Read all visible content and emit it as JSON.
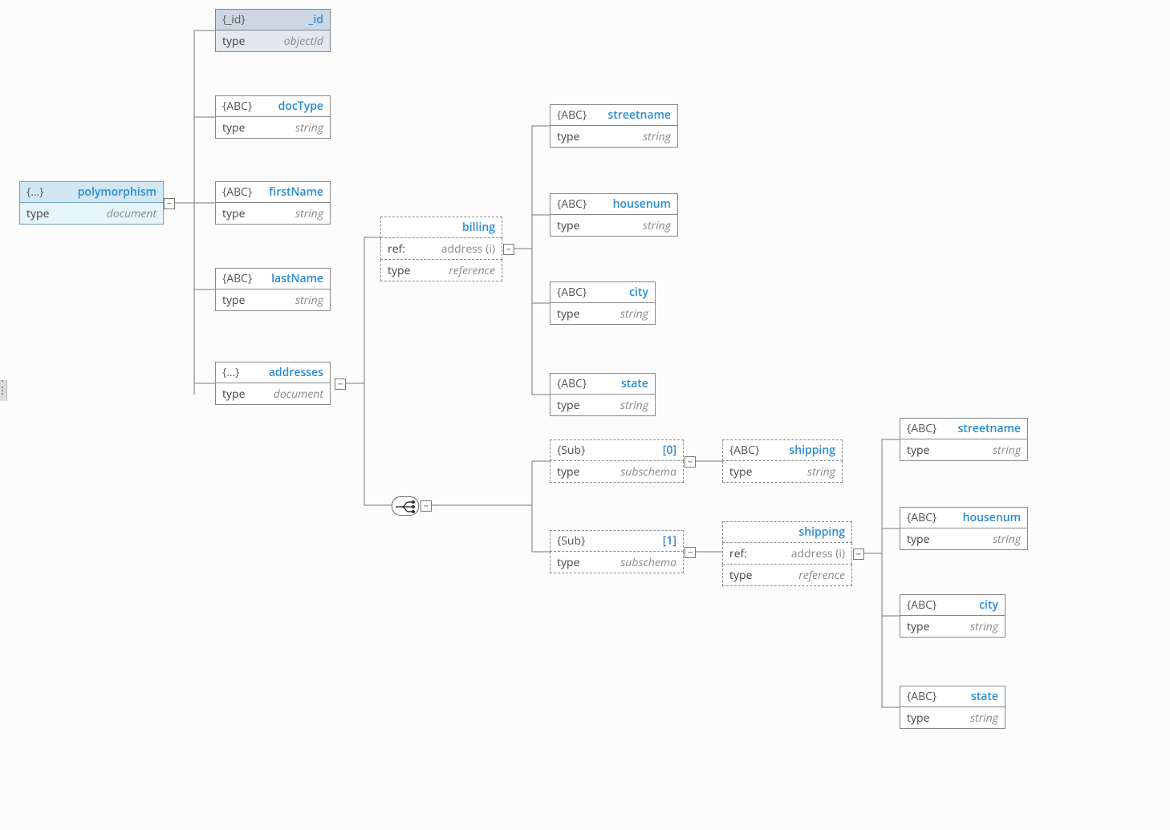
{
  "labels": {
    "type": "type",
    "ref": "ref:"
  },
  "types": {
    "document": "document",
    "objectId": "objectId",
    "string": "string",
    "reference": "reference",
    "subschema": "subschema"
  },
  "tags": {
    "obj": "{…}",
    "id": "{_id}",
    "abc": "{ABC}",
    "sub": "{Sub}"
  },
  "root": {
    "name": "polymorphism",
    "type": "document"
  },
  "fields": {
    "id": {
      "name": "_id",
      "type": "objectId"
    },
    "docType": {
      "name": "docType",
      "type": "string"
    },
    "firstName": {
      "name": "firstName",
      "type": "string"
    },
    "lastName": {
      "name": "lastName",
      "type": "string"
    },
    "addresses": {
      "name": "addresses",
      "type": "document"
    }
  },
  "billing": {
    "name": "billing",
    "ref": "address (i)",
    "type": "reference",
    "fields": {
      "streetname": {
        "name": "streetname",
        "type": "string"
      },
      "housenum": {
        "name": "housenum",
        "type": "string"
      },
      "city": {
        "name": "city",
        "type": "string"
      },
      "state": {
        "name": "state",
        "type": "string"
      }
    }
  },
  "oneof": {
    "0": {
      "idx": "[0]",
      "type": "subschema",
      "child": {
        "name": "shipping",
        "type": "string"
      }
    },
    "1": {
      "idx": "[1]",
      "type": "subschema",
      "child": {
        "name": "shipping",
        "ref": "address (i)",
        "type": "reference",
        "fields": {
          "streetname": {
            "name": "streetname",
            "type": "string"
          },
          "housenum": {
            "name": "housenum",
            "type": "string"
          },
          "city": {
            "name": "city",
            "type": "string"
          },
          "state": {
            "name": "state",
            "type": "string"
          }
        }
      }
    }
  }
}
